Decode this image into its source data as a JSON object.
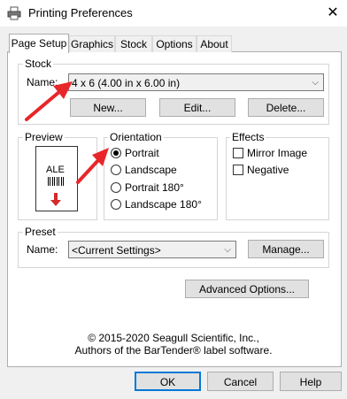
{
  "window": {
    "title": "Printing Preferences",
    "close_glyph": "✕"
  },
  "tabs": [
    "Page Setup",
    "Graphics",
    "Stock",
    "Options",
    "About"
  ],
  "stock": {
    "group_label": "Stock",
    "name_label": "Name:",
    "name_value": "4 x 6 (4.00 in x 6.00 in)",
    "new_button": "New...",
    "edit_button": "Edit...",
    "delete_button": "Delete..."
  },
  "preview": {
    "group_label": "Preview",
    "sample_text": "ALE"
  },
  "orientation": {
    "group_label": "Orientation",
    "options": [
      "Portrait",
      "Landscape",
      "Portrait 180°",
      "Landscape 180°"
    ],
    "selected": "Portrait"
  },
  "effects": {
    "group_label": "Effects",
    "options": [
      "Mirror Image",
      "Negative"
    ]
  },
  "preset": {
    "group_label": "Preset",
    "name_label": "Name:",
    "name_value": "<Current Settings>",
    "manage_button": "Manage..."
  },
  "advanced_button": "Advanced Options...",
  "copyright": {
    "line1": "© 2015-2020 Seagull Scientific, Inc.,",
    "line2": "Authors of the BarTender® label software."
  },
  "footer": {
    "ok": "OK",
    "cancel": "Cancel",
    "help": "Help"
  },
  "annotation_color": "#e8262a"
}
